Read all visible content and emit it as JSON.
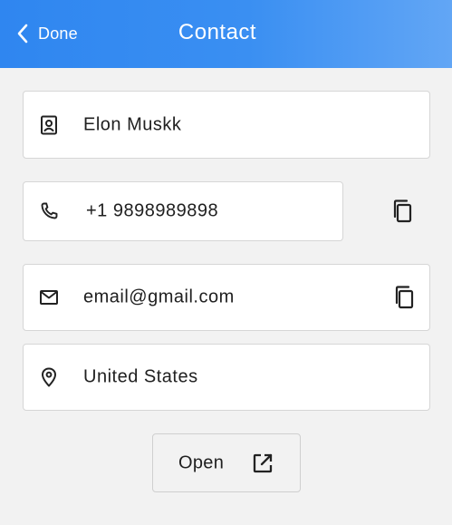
{
  "header": {
    "back_label": "Done",
    "title": "Contact",
    "colors": {
      "gradient_start": "#2f86f0",
      "gradient_end": "#62a6f5",
      "text": "#ffffff"
    }
  },
  "fields": {
    "name": {
      "icon": "contact-card-icon",
      "value": "Elon Muskk"
    },
    "phone": {
      "icon": "phone-icon",
      "value": "+1 9898989898",
      "copy_icon": "copy-icon"
    },
    "email": {
      "icon": "mail-icon",
      "value": "email@gmail.com",
      "copy_icon": "copy-icon"
    },
    "location": {
      "icon": "location-pin-icon",
      "value": "United States"
    }
  },
  "open_button": {
    "label": "Open",
    "icon": "open-external-icon"
  }
}
